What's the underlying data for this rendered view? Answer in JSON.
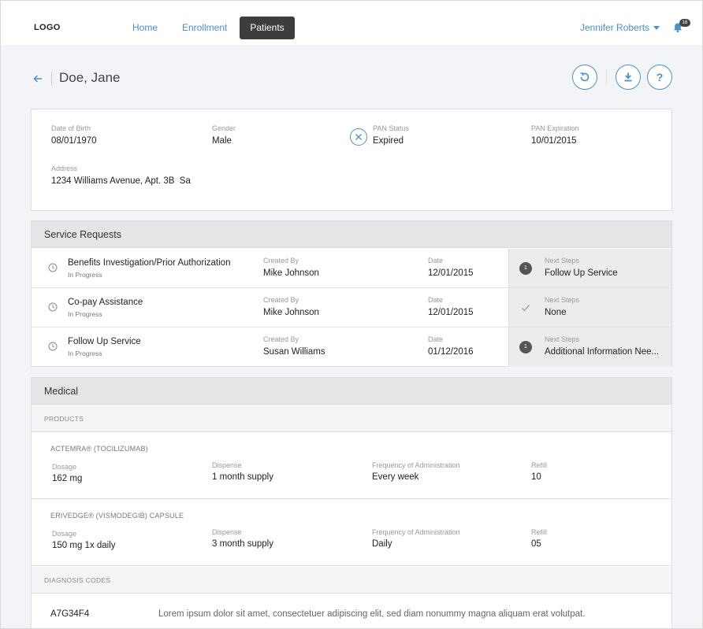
{
  "header": {
    "logo": "LOGO",
    "nav": [
      {
        "label": "Home"
      },
      {
        "label": "Enrollment"
      },
      {
        "label": "Patients"
      }
    ],
    "user_name": "Jennifer Roberts",
    "notification_count": "18"
  },
  "patient": {
    "name": "Doe, Jane",
    "dob_label": "Date of Birth",
    "dob": "08/01/1970",
    "gender_label": "Gender",
    "gender": "Male",
    "pan_status_label": "PAN Status",
    "pan_status": "Expired",
    "pan_exp_label": "PAN Expiration",
    "pan_exp": "10/01/2015",
    "address_label": "Address",
    "address": "1234 Williams Avenue, Apt. 3B  Sa"
  },
  "service_requests": {
    "title": "Service Requests",
    "created_by_label": "Created By",
    "date_label": "Date",
    "next_steps_label": "Next Steps",
    "rows": [
      {
        "title": "Benefits Investigation/Prior Authorization",
        "status": "In Progress",
        "created_by": "Mike Johnson",
        "date": "12/01/2015",
        "step_badge": "1",
        "next_steps": "Follow Up Service"
      },
      {
        "title": "Co-pay Assistance",
        "status": "In Progress",
        "created_by": "Mike Johnson",
        "date": "12/01/2015",
        "step_badge": "",
        "next_steps": "None"
      },
      {
        "title": "Follow Up Service",
        "status": "In Progress",
        "created_by": "Susan Williams",
        "date": "01/12/2016",
        "step_badge": "1",
        "next_steps": "Additional Information Nee..."
      }
    ]
  },
  "medical": {
    "title": "Medical",
    "products_label": "PRODUCTS",
    "dosage_label": "Dosage",
    "dispense_label": "Dispense",
    "frequency_label": "Frequency of Administration",
    "refill_label": "Refill",
    "products": [
      {
        "name": "ACTEMRA® (TOCILIZUMAB)",
        "dosage": "162 mg",
        "dispense": "1 month supply",
        "frequency": "Every week",
        "refill": "10"
      },
      {
        "name": "ERIVEDGE® (VISMODEGIB) CAPSULE",
        "dosage": "150 mg 1x daily",
        "dispense": "3 month supply",
        "frequency": "Daily",
        "refill": "05"
      }
    ],
    "diagnosis_label": "DIAGNOSIS CODES",
    "diagnosis": [
      {
        "code": "A7G34F4",
        "description": "Lorem ipsum dolor sit amet, consectetuer adipiscing elit, sed diam nonummy magna aliquam erat volutpat."
      }
    ]
  },
  "colors": {
    "accent": "#4a90c8",
    "nav_active": "#3d3d3d"
  }
}
